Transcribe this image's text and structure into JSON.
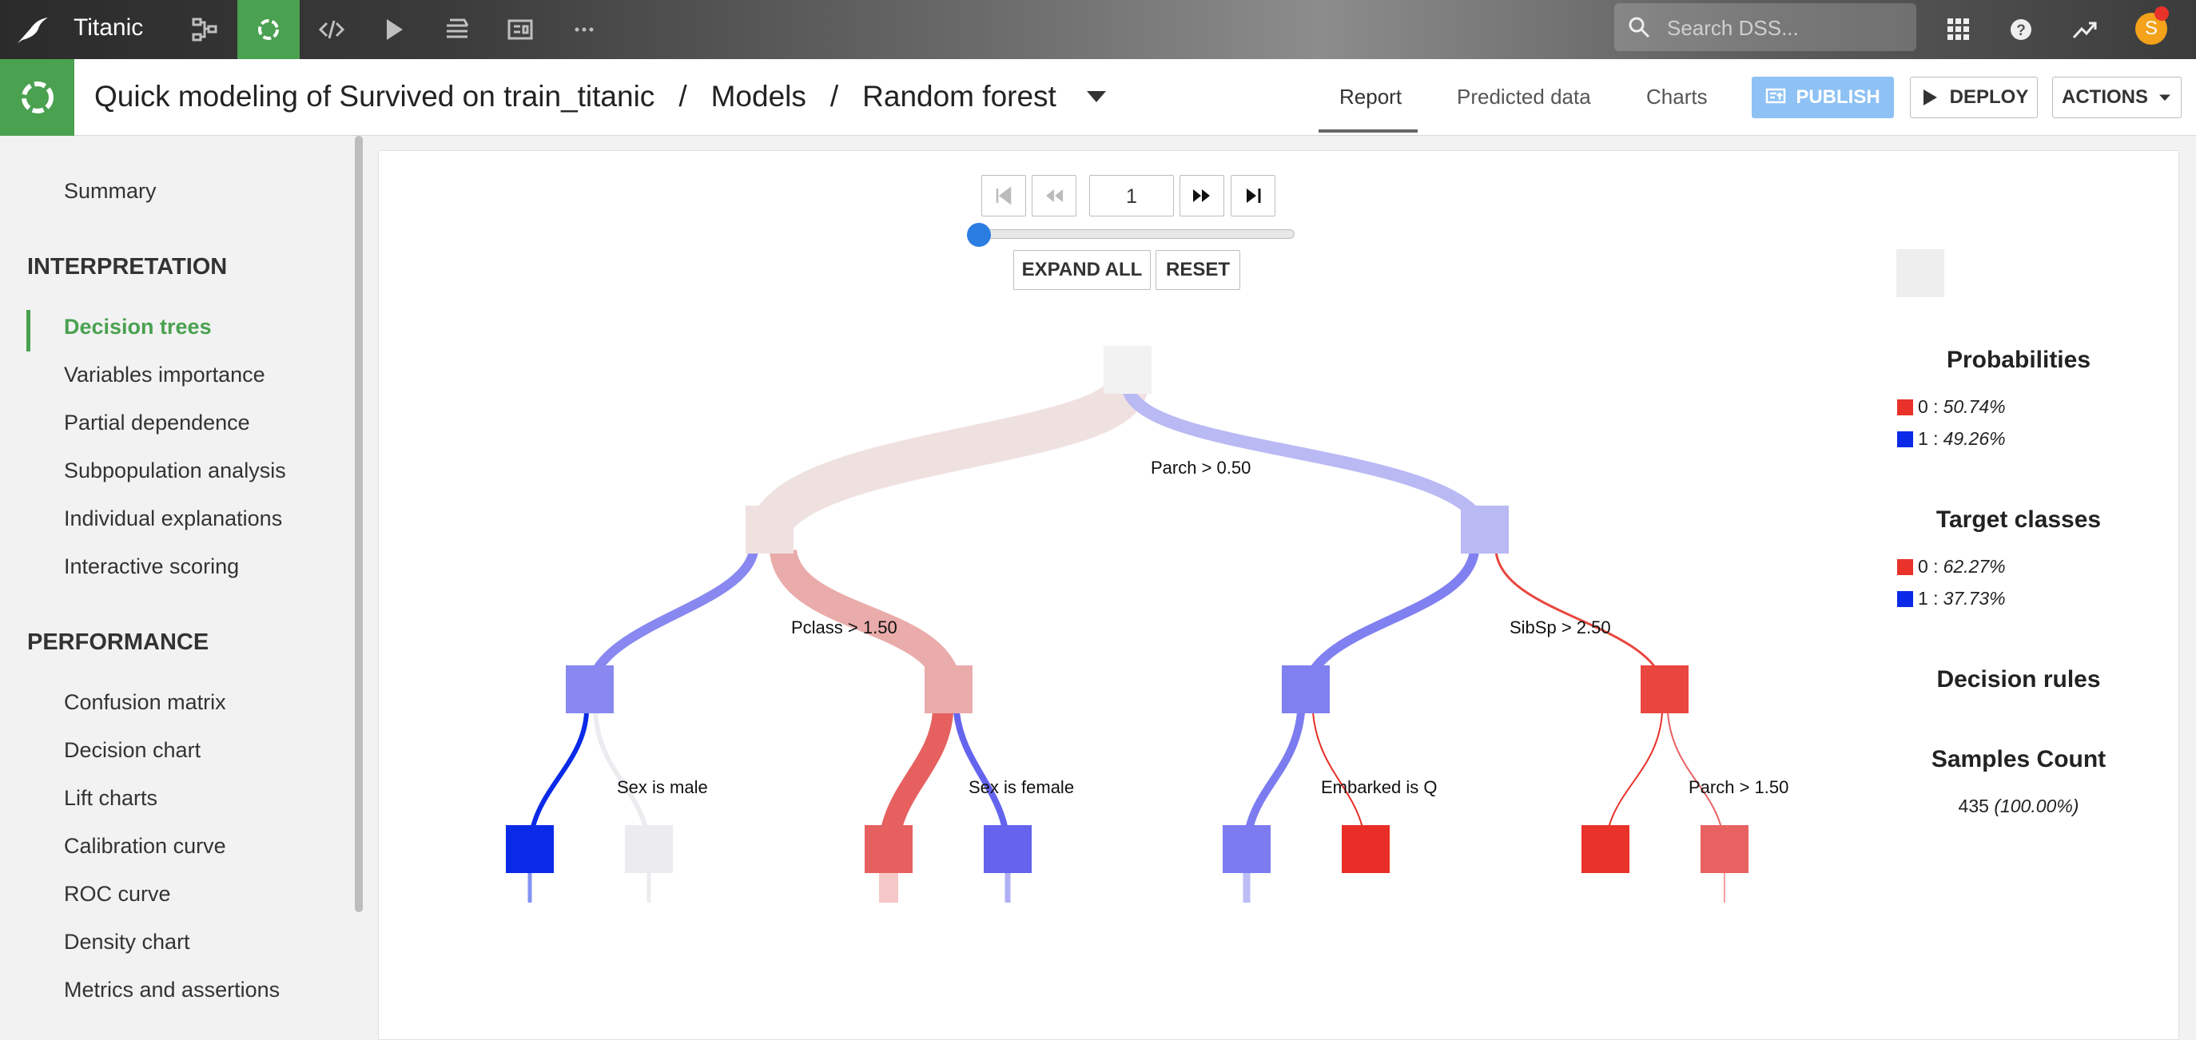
{
  "app": {
    "project_name": "Titanic",
    "search_placeholder": "Search DSS...",
    "avatar_initial": "S"
  },
  "breadcrumb": {
    "part1": "Quick modeling of Survived on train_titanic",
    "sep": "/",
    "part2": "Models",
    "part3": "Random forest"
  },
  "tabs": {
    "report": "Report",
    "predicted_data": "Predicted data",
    "charts": "Charts"
  },
  "buttons": {
    "publish": "PUBLISH",
    "deploy": "DEPLOY",
    "actions": "ACTIONS"
  },
  "sidebar": {
    "summary": "Summary",
    "interpretation_title": "INTERPRETATION",
    "interpretation_items": [
      "Decision trees",
      "Variables importance",
      "Partial dependence",
      "Subpopulation analysis",
      "Individual explanations",
      "Interactive scoring"
    ],
    "performance_title": "PERFORMANCE",
    "performance_items": [
      "Confusion matrix",
      "Decision chart",
      "Lift charts",
      "Calibration curve",
      "ROC curve",
      "Density chart",
      "Metrics and assertions"
    ]
  },
  "tree_controls": {
    "page_value": "1",
    "slider_fraction": 0,
    "expand_all": "EXPAND ALL",
    "reset": "RESET"
  },
  "tree": {
    "splits": {
      "root": "Parch > 0.50",
      "left": "Pclass > 1.50",
      "right": "SibSp > 2.50",
      "ll": "Sex is male",
      "lr": "Sex is female",
      "rl": "Embarked is Q",
      "rr": "Parch > 1.50"
    },
    "colors": {
      "root": "#f2f2f2",
      "l": "#f0e1e1",
      "r": "#b9b9f4",
      "ll": "#8888f0",
      "lr": "#eaabab",
      "rl": "#8080f0",
      "rr": "#e8463e",
      "lll": "#0a2ae8",
      "llr": "#ececf0",
      "lrl": "#e66060",
      "lrr": "#6464ee",
      "rll": "#7c7cf0",
      "rlr": "#e82e26",
      "rrl": "#e8322a",
      "rrr": "#e86262"
    }
  },
  "legend": {
    "probabilities_title": "Probabilities",
    "prob_rows": [
      {
        "label": "0 :",
        "value": "50.74%",
        "color": "#e8322a"
      },
      {
        "label": "1 :",
        "value": "49.26%",
        "color": "#0a2ae8"
      }
    ],
    "target_title": "Target classes",
    "target_rows": [
      {
        "label": "0 :",
        "value": "62.27%",
        "color": "#e8322a"
      },
      {
        "label": "1 :",
        "value": "37.73%",
        "color": "#0a2ae8"
      }
    ],
    "rules_title": "Decision rules",
    "samples_title": "Samples Count",
    "samples_value": "435",
    "samples_pct": "(100.00%)"
  }
}
